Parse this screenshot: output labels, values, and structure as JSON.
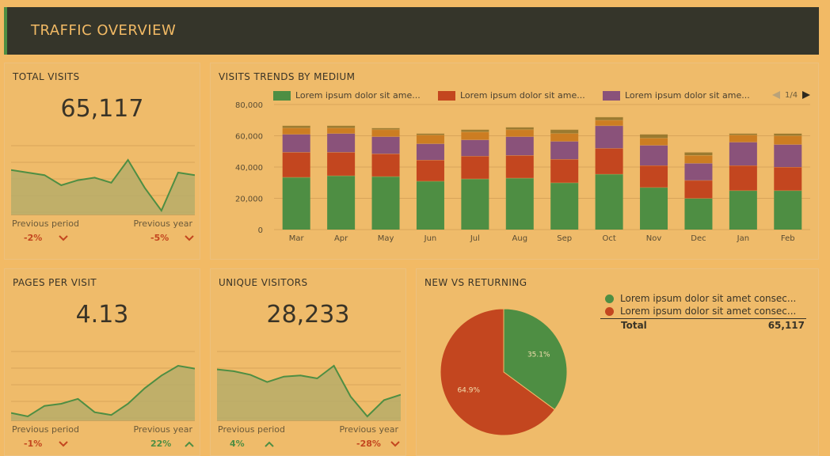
{
  "header": {
    "title": "TRAFFIC OVERVIEW"
  },
  "colors": {
    "green": "#4e8e43",
    "red": "#c3461f",
    "purple": "#8a527a",
    "orange": "#cc7d22",
    "area": "#b7ad69",
    "line": "#4e8e43"
  },
  "total_visits": {
    "title": "TOTAL VISITS",
    "value": "65,117",
    "prev_period_label": "Previous period",
    "prev_period_value": "-2%",
    "prev_year_label": "Previous year",
    "prev_year_value": "-5%"
  },
  "pages_per_visit": {
    "title": "PAGES PER VISIT",
    "value": "4.13",
    "prev_period_label": "Previous period",
    "prev_period_value": "-1%",
    "prev_year_label": "Previous year",
    "prev_year_value": "22%"
  },
  "unique_visitors": {
    "title": "UNIQUE VISITORS",
    "value": "28,233",
    "prev_period_label": "Previous period",
    "prev_period_value": "4%",
    "prev_year_label": "Previous year",
    "prev_year_value": "-28%"
  },
  "trends": {
    "title": "VISITS TRENDS BY MEDIUM",
    "legend": [
      "Lorem ipsum dolor sit ame...",
      "Lorem ipsum dolor sit ame...",
      "Lorem ipsum dolor sit ame..."
    ],
    "pager": "1/4"
  },
  "new_vs_returning": {
    "title": "NEW VS RETURNING",
    "legend": [
      "Lorem ipsum dolor sit amet consec...",
      "Lorem ipsum dolor sit amet consec..."
    ],
    "total_label": "Total",
    "total_value": "65,117"
  },
  "chart_data": [
    {
      "type": "area",
      "name": "total-visits-sparkline",
      "values": [
        61,
        60,
        59,
        55,
        57,
        58,
        56,
        65,
        54,
        45,
        60,
        59
      ]
    },
    {
      "type": "bar",
      "stacked": true,
      "title": "VISITS TRENDS BY MEDIUM",
      "categories": [
        "Mar",
        "Apr",
        "May",
        "Jun",
        "Jul",
        "Aug",
        "Sep",
        "Oct",
        "Nov",
        "Dec",
        "Jan",
        "Feb"
      ],
      "series": [
        {
          "values": [
            33500,
            34500,
            34000,
            31000,
            32500,
            33000,
            30000,
            35500,
            27000,
            20000,
            25000,
            25000
          ]
        },
        {
          "values": [
            16000,
            15000,
            14500,
            13500,
            14500,
            14500,
            15000,
            16500,
            14000,
            11500,
            16000,
            15000
          ]
        },
        {
          "values": [
            11500,
            12000,
            11000,
            10500,
            10500,
            12000,
            11500,
            14500,
            13000,
            11000,
            15000,
            14500
          ]
        },
        {
          "values": [
            4000,
            3500,
            4500,
            5500,
            5000,
            4500,
            5000,
            3500,
            4500,
            5000,
            4500,
            5500
          ]
        },
        {
          "values": [
            1500,
            1500,
            1000,
            1000,
            1500,
            1500,
            2500,
            2000,
            2500,
            2000,
            1000,
            1500
          ]
        }
      ],
      "ylim": [
        0,
        80000
      ],
      "yticks": [
        "0",
        "20,000",
        "40,000",
        "60,000",
        "80,000"
      ],
      "grid": true,
      "legend_position": "top"
    },
    {
      "type": "pie",
      "title": "NEW VS RETURNING",
      "values": [
        35.1,
        64.9
      ],
      "labels": [
        "35.1%",
        "64.9%"
      ]
    },
    {
      "type": "area",
      "name": "pages-per-visit-sparkline",
      "values": [
        3.85,
        3.8,
        3.95,
        3.98,
        4.05,
        3.86,
        3.82,
        3.98,
        4.2,
        4.38,
        4.52,
        4.48
      ]
    },
    {
      "type": "area",
      "name": "unique-visitors-sparkline",
      "values": [
        29500,
        29000,
        28000,
        26000,
        27500,
        27800,
        27000,
        30500,
        22000,
        16500,
        21000,
        22500
      ]
    }
  ]
}
